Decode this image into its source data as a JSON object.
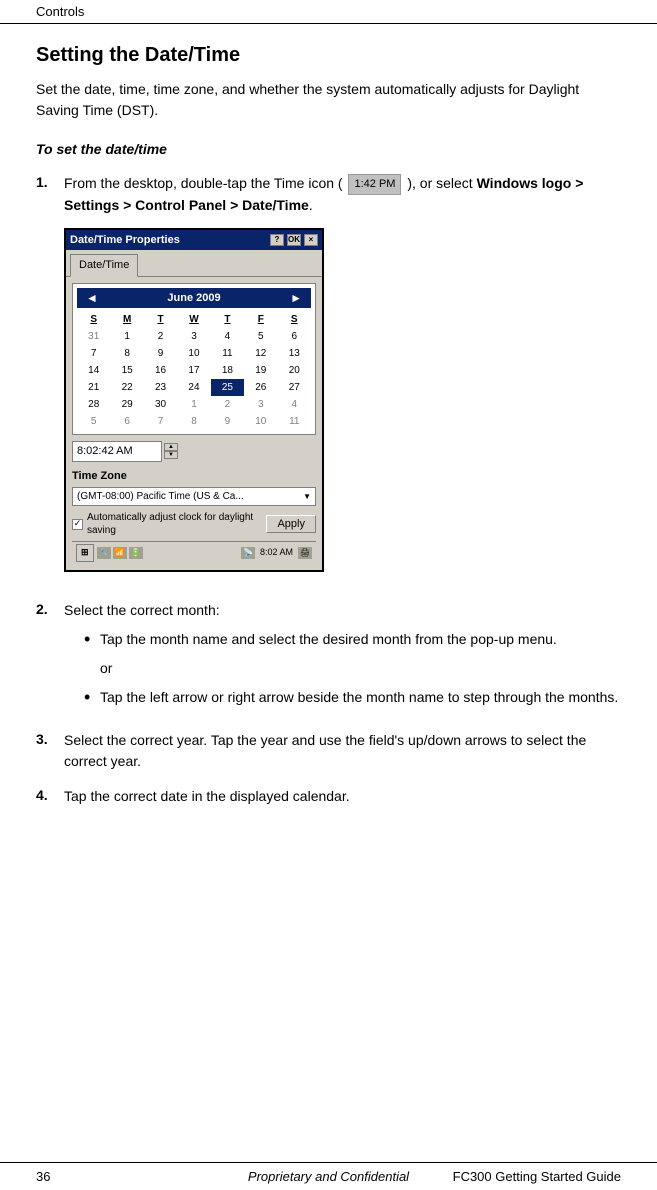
{
  "topbar": {
    "label": "Controls"
  },
  "page": {
    "title": "Setting the Date/Time",
    "intro": "Set the date, time, time zone, and whether the system automatically adjusts for Daylight Saving Time (DST).",
    "section_heading": "To set the date/time"
  },
  "steps": [
    {
      "number": "1.",
      "text_before": "From the desktop, double-tap the Time icon (",
      "time_icon_text": "1:42 PM",
      "text_after": "), or select ",
      "bold_text": "Windows logo > Settings > Control Panel > Date/Time",
      "text_end": "."
    },
    {
      "number": "2.",
      "text": "Select the correct month:"
    },
    {
      "number": "3.",
      "text": "Select the correct year. Tap the year and use the field's up/down arrows to select the correct year."
    },
    {
      "number": "4.",
      "text": "Tap the correct date in the displayed calendar."
    }
  ],
  "bullets": [
    {
      "text": "Tap the month name and select the desired month from the pop-up menu."
    },
    {
      "text": "Tap the left arrow or right arrow beside the month name to step through the months."
    }
  ],
  "or_text": "or",
  "dialog": {
    "title": "Date/Time Properties",
    "title_btns": [
      "?",
      "OK",
      "×"
    ],
    "tab": "Date/Time",
    "month_year": "June 2009",
    "days_header": [
      "S",
      "M",
      "T",
      "W",
      "T",
      "F",
      "S"
    ],
    "weeks": [
      [
        "31",
        "1",
        "2",
        "3",
        "4",
        "5",
        "6"
      ],
      [
        "7",
        "8",
        "9",
        "10",
        "11",
        "12",
        "13"
      ],
      [
        "14",
        "15",
        "16",
        "17",
        "18",
        "19",
        "20"
      ],
      [
        "21",
        "22",
        "23",
        "24",
        "25",
        "26",
        "27"
      ],
      [
        "28",
        "29",
        "30",
        "1",
        "2",
        "3",
        "4"
      ],
      [
        "5",
        "6",
        "7",
        "8",
        "9",
        "10",
        "11"
      ]
    ],
    "selected_day": "25",
    "other_month_days": [
      "31",
      "1",
      "2",
      "3",
      "4",
      "5",
      "6",
      "7",
      "8",
      "9",
      "10",
      "11"
    ],
    "time_value": "8:02:42 AM",
    "timezone_label": "Time Zone",
    "timezone_value": "(GMT-08:00) Pacific Time (US & Ca...",
    "dst_label": "Automatically adjust clock for daylight saving",
    "dst_checked": true,
    "apply_label": "Apply",
    "taskbar_time": "8:02 AM"
  },
  "footer": {
    "left": "36",
    "center": "Proprietary and Confidential",
    "right": "FC300  Getting Started Guide"
  }
}
